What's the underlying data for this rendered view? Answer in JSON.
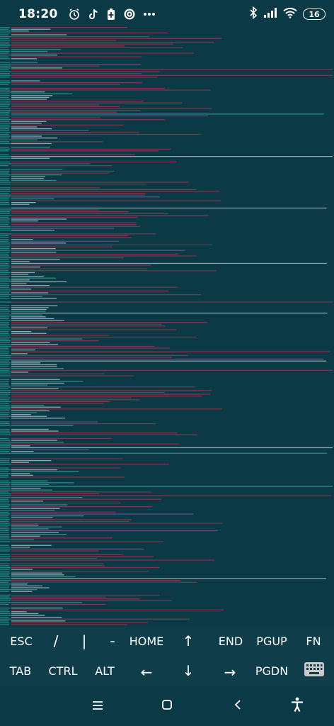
{
  "status_bar": {
    "time": "18:20",
    "battery_level": "16",
    "left_icons": [
      "alarm-icon",
      "tiktok-icon",
      "battery-saver-icon",
      "cloud-app-icon",
      "more-dots-icon"
    ],
    "right_icons": [
      "bluetooth-icon",
      "signal-icon",
      "wifi-icon"
    ]
  },
  "terminal": {
    "background_color": "#0b3a46",
    "line_colors": {
      "prefix": "#2a9d8f",
      "text": "#c8d3d6",
      "error": "#b0314f",
      "info": "#3fae9e",
      "link": "#7a5a9e"
    }
  },
  "extra_keys": {
    "row1": [
      "ESC",
      "/",
      "|",
      "-",
      "HOME",
      "↑",
      "END",
      "PGUP",
      "FN"
    ],
    "row2": [
      "TAB",
      "CTRL",
      "ALT",
      "←",
      "↓",
      "→",
      "PGDN"
    ],
    "keyboard_toggle_icon": "keyboard-icon"
  },
  "nav_bar": {
    "buttons": [
      "menu-icon",
      "home-icon",
      "back-icon",
      "accessibility-icon"
    ]
  }
}
